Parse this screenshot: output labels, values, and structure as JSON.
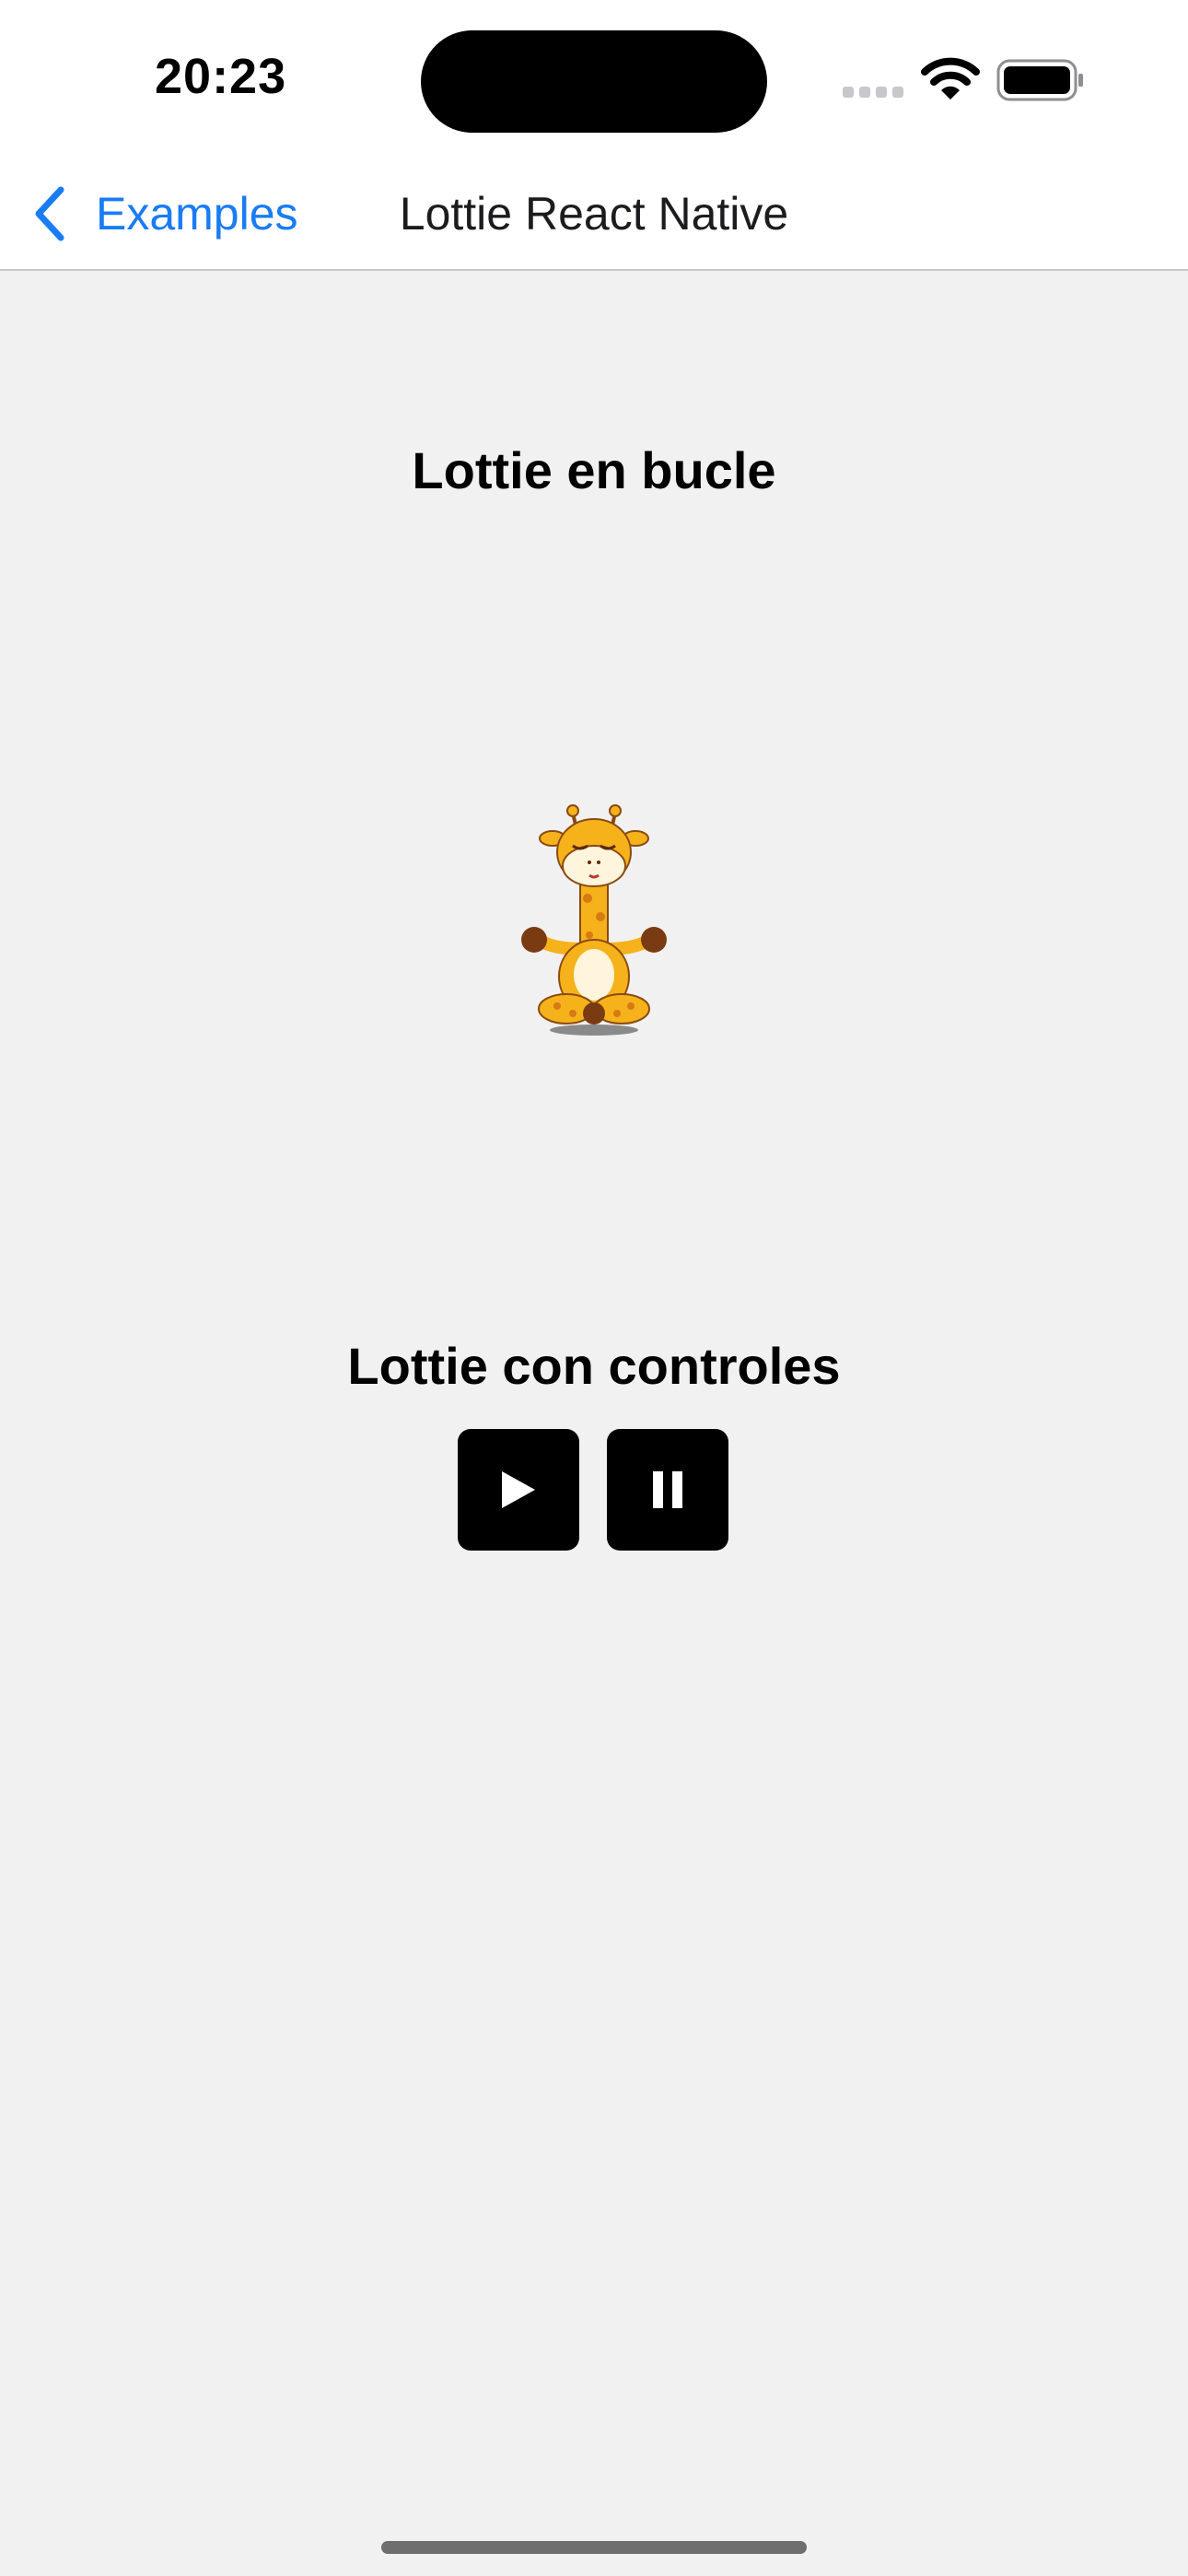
{
  "status_bar": {
    "time": "20:23",
    "icons": [
      "signal-icon",
      "wifi-icon",
      "battery-icon"
    ]
  },
  "nav": {
    "back_label": "Examples",
    "back_icon": "chevron-left-icon",
    "title": "Lottie React Native",
    "accent_color": "#1a7cf3"
  },
  "sections": {
    "loop_title": "Lottie en bucle",
    "controls_title": "Lottie con controles"
  },
  "animation": {
    "icon": "giraffe-meditating-icon"
  },
  "controls": {
    "play_icon": "play-icon",
    "pause_icon": "pause-icon"
  }
}
